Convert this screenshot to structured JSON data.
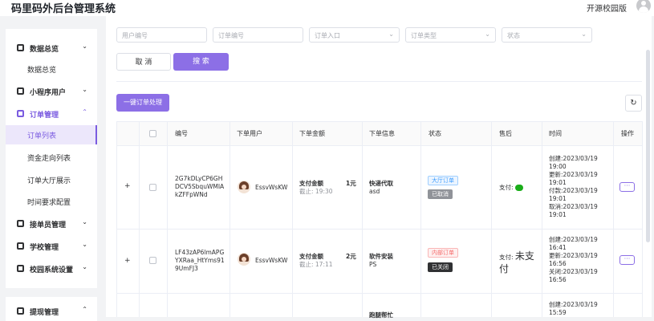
{
  "app": {
    "title": "码里码外后台管理系统",
    "version": "开源校园版"
  },
  "sidebar": {
    "items": [
      {
        "label": "数据总览",
        "icon": "dashboard-icon",
        "chevron": "⌄"
      },
      {
        "label": "数据总览",
        "sub": true
      },
      {
        "label": "小程序用户",
        "icon": "user-icon",
        "chevron": "⌄"
      },
      {
        "label": "订单管理",
        "icon": "order-icon",
        "chevron": "⌃"
      },
      {
        "label": "订单列表",
        "sub": true,
        "active": true
      },
      {
        "label": "资金走向列表",
        "sub": true
      },
      {
        "label": "订单大厅展示",
        "sub": true
      },
      {
        "label": "时间要求配置",
        "sub": true
      },
      {
        "label": "接单员管理",
        "icon": "rider-icon",
        "chevron": "⌄"
      },
      {
        "label": "学校管理",
        "icon": "school-icon",
        "chevron": "⌄"
      },
      {
        "label": "校园系统设置",
        "icon": "settings-icon",
        "chevron": "⌄"
      },
      {
        "label": "提现管理",
        "icon": "withdraw-icon",
        "chevron": "⌃"
      }
    ]
  },
  "filters": {
    "user_no": "用户编号",
    "order_no": "订单编号",
    "entry": "订单入口",
    "type": "订单类型",
    "status": "状态",
    "cancel": "取 消",
    "search": "搜 索"
  },
  "toolbar": {
    "batch": "一键订单处理",
    "refresh": "↻"
  },
  "table": {
    "headers": [
      "编号",
      "下单用户",
      "下单金额",
      "下单信息",
      "状态",
      "售后",
      "时间",
      "操作"
    ],
    "rows": [
      {
        "expand": "+",
        "id_lines": [
          "2G7kDLyCP6GH",
          "DCV5SbquWMIA",
          "kZFFpWNd"
        ],
        "user": "EssvWsKW",
        "amount_label": "支付金额",
        "amount": "1元",
        "deadline": "截止: 19:30",
        "info_title": "快递代取",
        "info_sub": "asd",
        "tag1": "大厅订单",
        "tag2": "已取消",
        "aftersale_label": "支付:",
        "time_lines": [
          "创建:2023/03/19",
          "19:00",
          "更新:2023/03/19",
          "19:01",
          "付款:2023/03/19",
          "19:01",
          "取消:2023/03/19",
          "19:01"
        ],
        "more": "···"
      },
      {
        "expand": "+",
        "id_lines": [
          "LF43zAP6lmAPG",
          "YXRaa_HtYms91",
          "9UmFJ3"
        ],
        "user": "EssvWsKW",
        "amount_label": "支付金额",
        "amount": "2元",
        "deadline": "截止: 17:11",
        "info_title": "软件安装",
        "info_sub": "PS",
        "tag1": "内部订单",
        "tag2": "已关闭",
        "aftersale_label": "支付:",
        "aftersale_value": "未支",
        "aftersale_value2": "付",
        "time_lines": [
          "创建:2023/03/19",
          "16:41",
          "更新:2023/03/19",
          "16:56",
          "关闭:2023/03/19",
          "16:56"
        ],
        "more": "···"
      },
      {
        "info_title": "跑腿帮忙",
        "time_lines": [
          "创建:2023/03/19",
          "15:59"
        ]
      }
    ]
  }
}
